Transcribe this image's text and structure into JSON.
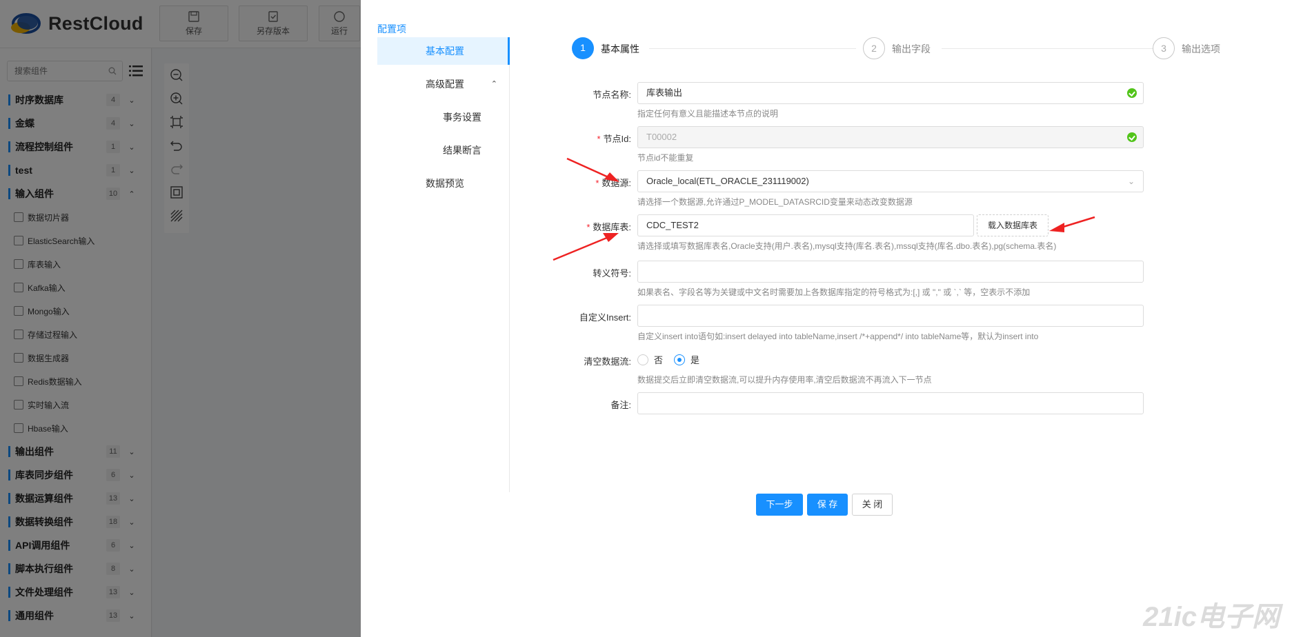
{
  "app": {
    "logo_text": "RestCloud",
    "toolbar": [
      {
        "label": "保存",
        "icon": "save-icon"
      },
      {
        "label": "另存版本",
        "icon": "save-version-icon"
      },
      {
        "label": "运行",
        "icon": "run-icon"
      }
    ],
    "search_placeholder": "搜索组件",
    "categories_top": [
      {
        "name": "时序数据库",
        "count": "4"
      },
      {
        "name": "金蝶",
        "count": "4"
      },
      {
        "name": "流程控制组件",
        "count": "1"
      },
      {
        "name": "test",
        "count": "1"
      },
      {
        "name": "输入组件",
        "count": "10",
        "expanded": true
      }
    ],
    "input_components": [
      "数据切片器",
      "ElasticSearch输入",
      "库表输入",
      "Kafka输入",
      "Mongo输入",
      "存储过程输入",
      "数据生成器",
      "Redis数据输入",
      "实时输入流",
      "Hbase输入"
    ],
    "categories_bottom": [
      {
        "name": "输出组件",
        "count": "11"
      },
      {
        "name": "库表同步组件",
        "count": "6"
      },
      {
        "name": "数据运算组件",
        "count": "13"
      },
      {
        "name": "数据转换组件",
        "count": "18"
      },
      {
        "name": "API调用组件",
        "count": "6"
      },
      {
        "name": "脚本执行组件",
        "count": "8"
      },
      {
        "name": "文件处理组件",
        "count": "13"
      },
      {
        "name": "通用组件",
        "count": "13"
      }
    ]
  },
  "drawer": {
    "title": "配置项",
    "menu": {
      "basic": "基本配置",
      "advanced": "高级配置",
      "transaction": "事务设置",
      "assert": "结果断言",
      "preview": "数据预览"
    },
    "steps": [
      {
        "num": "1",
        "label": "基本属性"
      },
      {
        "num": "2",
        "label": "输出字段"
      },
      {
        "num": "3",
        "label": "输出选项"
      }
    ],
    "form": {
      "node_name": {
        "label": "节点名称:",
        "value": "库表输出",
        "hint": "指定任何有意义且能描述本节点的说明"
      },
      "node_id": {
        "label": "节点Id:",
        "value": "T00002",
        "hint": "节点id不能重复"
      },
      "datasource": {
        "label": "数据源:",
        "value": "Oracle_local(ETL_ORACLE_231119002)",
        "hint": "请选择一个数据源,允许通过P_MODEL_DATASRCID变量来动态改变数据源"
      },
      "table": {
        "label": "数据库表:",
        "value": "CDC_TEST2",
        "load_button": "载入数据库表",
        "hint": "请选择或填写数据库表名,Oracle支持(用户.表名),mysql支持(库名.表名),mssql支持(库名.dbo.表名),pg(schema.表名)"
      },
      "escape": {
        "label": "转义符号:",
        "value": "",
        "hint": "如果表名、字段名等为关键或中文名时需要加上各数据库指定的符号格式为:[,] 或 \",\" 或 `,` 等，空表示不添加"
      },
      "custom_insert": {
        "label": "自定义Insert:",
        "value": "",
        "hint": "自定义insert into语句如:insert delayed into tableName,insert /*+append*/ into tableName等，默认为insert into"
      },
      "clear_stream": {
        "label": "清空数据流:",
        "option_no": "否",
        "option_yes": "是",
        "selected": "是",
        "hint": "数据提交后立即清空数据流,可以提升内存使用率,清空后数据流不再流入下一节点"
      },
      "remark": {
        "label": "备注:",
        "value": ""
      }
    },
    "buttons": {
      "next": "下一步",
      "save": "保 存",
      "close": "关 闭"
    }
  },
  "watermark": "21ic电子网",
  "colors": {
    "primary": "#1890ff",
    "success": "#52c41a",
    "required": "#f5222d",
    "arrow": "#ee2222"
  }
}
